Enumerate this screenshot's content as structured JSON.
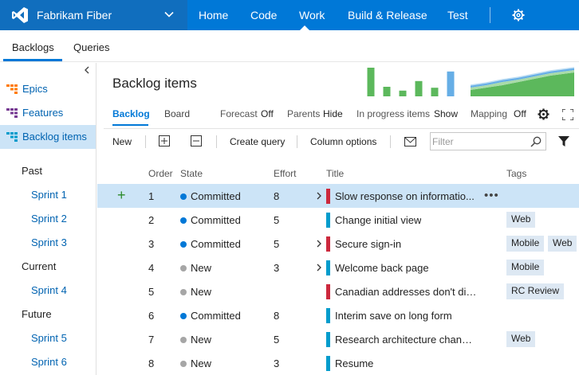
{
  "colors": {
    "topbar": "#0078d7",
    "brand_bg": "#106ebe",
    "accent": "#0078d7",
    "selected_row": "#cce4f7",
    "committed": "#0078d7",
    "new": "#a6a6a6",
    "bug": "#cc293d",
    "story": "#009ccc",
    "tag_bg": "#dde8f3",
    "velocity": "#5cb85c",
    "velocity_highlight": "#66aee6"
  },
  "brand": {
    "name": "Fabrikam Fiber",
    "logo_icon": "visual-studio-icon"
  },
  "topnav": {
    "items": [
      "Home",
      "Code",
      "Work",
      "Build & Release",
      "Test"
    ],
    "selected": "Work"
  },
  "subnav": {
    "tabs": [
      "Backlogs",
      "Queries"
    ],
    "selected": "Backlogs"
  },
  "leftpane": {
    "items": [
      {
        "label": "Epics",
        "icon": "epic-icon"
      },
      {
        "label": "Features",
        "icon": "feature-icon"
      },
      {
        "label": "Backlog items",
        "icon": "backlog-icon"
      }
    ],
    "sections": {
      "past": "Past",
      "past_sprints": [
        "Sprint 1",
        "Sprint 2",
        "Sprint 3"
      ],
      "current": "Current",
      "current_sprints": [
        "Sprint 4"
      ],
      "future": "Future",
      "future_sprints": [
        "Sprint 5",
        "Sprint 6"
      ]
    }
  },
  "main": {
    "title": "Backlog items",
    "pivots": [
      "Backlog",
      "Board"
    ],
    "options": {
      "forecast_label": "Forecast",
      "forecast_value": "Off",
      "parents_label": "Parents",
      "parents_value": "Hide",
      "inprogress_label": "In progress items",
      "inprogress_value": "Show",
      "mapping_label": "Mapping",
      "mapping_value": "Off"
    },
    "toolbar": {
      "new": "New",
      "create_query": "Create query",
      "column_options": "Column options",
      "filter_placeholder": "Filter"
    }
  },
  "table": {
    "columns": [
      "Order",
      "State",
      "Effort",
      "Title",
      "Tags"
    ],
    "rows": [
      {
        "order": "1",
        "state": "Committed",
        "effort": "8",
        "title": "Slow response on informatio...",
        "type": "bug",
        "expand": true,
        "tags": [],
        "selected": true
      },
      {
        "order": "2",
        "state": "Committed",
        "effort": "5",
        "title": "Change initial view",
        "type": "story",
        "expand": false,
        "tags": [
          "Web"
        ]
      },
      {
        "order": "3",
        "state": "Committed",
        "effort": "5",
        "title": "Secure sign-in",
        "type": "bug",
        "expand": true,
        "tags": [
          "Mobile",
          "Web"
        ]
      },
      {
        "order": "4",
        "state": "New",
        "effort": "3",
        "title": "Welcome back page",
        "type": "story",
        "expand": true,
        "tags": [
          "Mobile"
        ]
      },
      {
        "order": "5",
        "state": "New",
        "effort": "",
        "title": "Canadian addresses don't display...",
        "type": "bug",
        "expand": false,
        "tags": [
          "RC Review"
        ]
      },
      {
        "order": "6",
        "state": "Committed",
        "effort": "8",
        "title": "Interim save on long form",
        "type": "story",
        "expand": false,
        "tags": []
      },
      {
        "order": "7",
        "state": "New",
        "effort": "5",
        "title": "Research architecture changes",
        "type": "story",
        "expand": false,
        "tags": [
          "Web"
        ]
      },
      {
        "order": "8",
        "state": "New",
        "effort": "3",
        "title": "Resume",
        "type": "story",
        "expand": false,
        "tags": []
      }
    ]
  },
  "charts": {
    "velocity": {
      "type": "bar",
      "values": [
        30,
        10,
        6,
        16,
        9,
        26
      ],
      "highlight_index": 5
    }
  }
}
